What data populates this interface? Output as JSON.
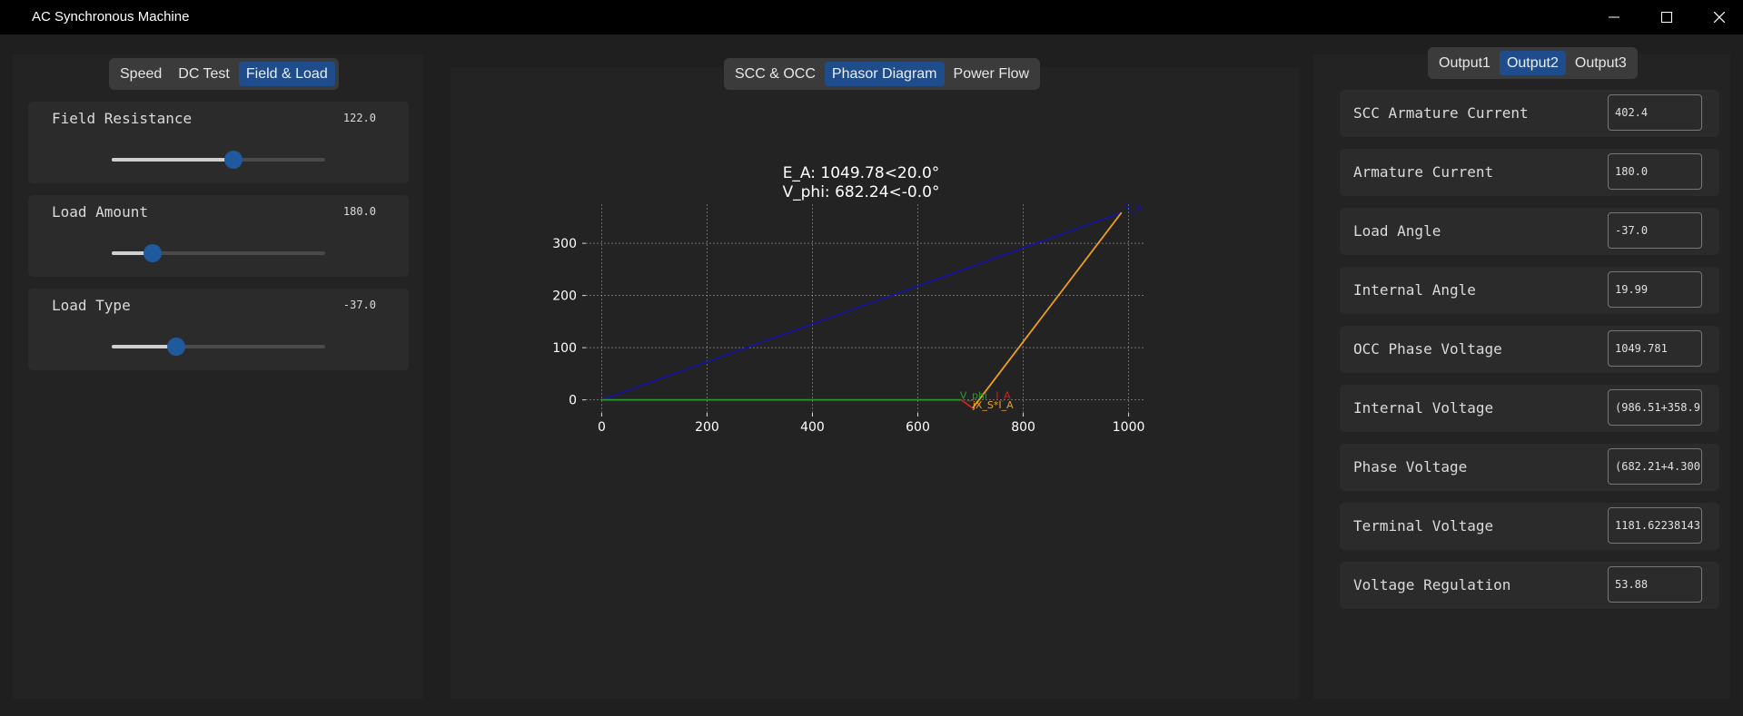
{
  "window": {
    "title": "AC Synchronous Machine"
  },
  "left_tabs": [
    "Speed",
    "DC Test",
    "Field & Load"
  ],
  "left_active": 2,
  "params": [
    {
      "label": "Field Resistance",
      "value": "122.0",
      "fraction": 0.57
    },
    {
      "label": "Load Amount",
      "value": "180.0",
      "fraction": 0.19
    },
    {
      "label": "Load Type",
      "value": "-37.0",
      "fraction": 0.3
    }
  ],
  "center_tabs": [
    "SCC & OCC",
    "Phasor Diagram",
    "Power Flow"
  ],
  "center_active": 1,
  "plot": {
    "title_line1": "E_A:  1049.78<20.0°",
    "title_line2": "V_phi: 682.24<-0.0°"
  },
  "chart_data": {
    "type": "line",
    "title": "E_A:  1049.78<20.0° / V_phi: 682.24<-0.0°",
    "xlim": [
      -30,
      1030
    ],
    "ylim": [
      -25,
      375
    ],
    "x_ticks": [
      0,
      200,
      400,
      600,
      800,
      1000
    ],
    "y_ticks": [
      0,
      100,
      200,
      300
    ],
    "grid": true,
    "series": [
      {
        "name": "E_A",
        "color": "#1515a0",
        "points": [
          [
            0,
            0
          ],
          [
            986.51,
            358.9
          ]
        ]
      },
      {
        "name": "V_phi",
        "color": "#2a9a2a",
        "points": [
          [
            0,
            0
          ],
          [
            682.21,
            0
          ]
        ]
      },
      {
        "name": "I_A",
        "color": "#d42020",
        "points": [
          [
            682.21,
            0
          ],
          [
            704,
            -16
          ]
        ]
      },
      {
        "name": "jX_S*I_A",
        "color": "#f0a020",
        "points": [
          [
            704,
            -16
          ],
          [
            986.51,
            358.9
          ]
        ]
      }
    ],
    "annotations": [
      {
        "text": "E_A",
        "x": 992,
        "y": 362,
        "color": "#1515a0"
      },
      {
        "text": "V_phi",
        "x": 680,
        "y": 2,
        "color": "#2a9a2a"
      },
      {
        "text": "I_A",
        "x": 748,
        "y": 2,
        "color": "#d42020"
      },
      {
        "text": "jX_S*I_A",
        "x": 704,
        "y": -16,
        "color": "#f0a020"
      }
    ]
  },
  "right_tabs": [
    "Output1",
    "Output2",
    "Output3"
  ],
  "right_active": 1,
  "outputs": [
    {
      "label": "SCC Armature Current",
      "value": "402.4"
    },
    {
      "label": "Armature Current",
      "value": "180.0"
    },
    {
      "label": "Load Angle",
      "value": "-37.0"
    },
    {
      "label": "Internal Angle",
      "value": "19.99"
    },
    {
      "label": "OCC Phase Voltage",
      "value": "1049.781"
    },
    {
      "label": "Internal Voltage",
      "value": "(986.51+358.9"
    },
    {
      "label": "Phase Voltage",
      "value": "(682.21+4.300"
    },
    {
      "label": "Terminal Voltage",
      "value": "1181.62238143"
    },
    {
      "label": "Voltage Regulation",
      "value": "53.88"
    }
  ]
}
